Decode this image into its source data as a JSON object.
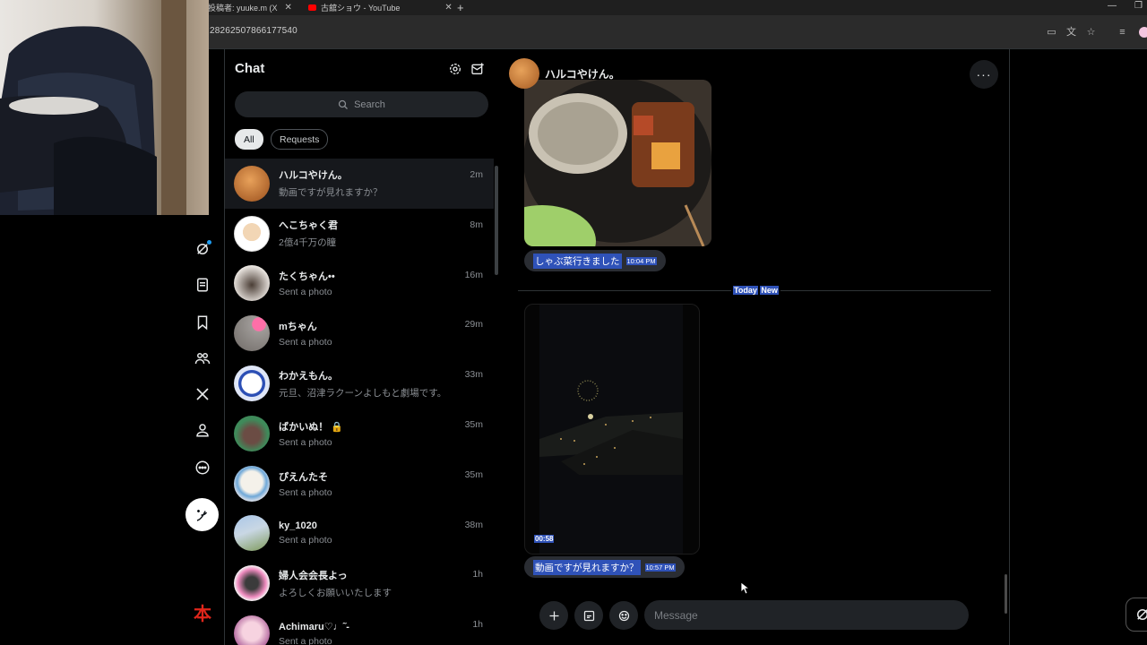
{
  "browser": {
    "tabs": [
      {
        "title": "投稿者: yuuke.m (X"
      },
      {
        "title": "古舘ショウ - YouTube"
      }
    ],
    "new_tab": "+",
    "url": "28262507866177540"
  },
  "chat_list": {
    "title": "Chat",
    "search": {
      "placeholder": "Search"
    },
    "filters": {
      "all": "All",
      "requests": "Requests"
    },
    "conversations": [
      {
        "name": "ハルコやけん。",
        "preview": "動画ですが見れますか？",
        "time": "2m",
        "selected": true
      },
      {
        "name": "へこちゃく君",
        "preview": "2億4千万の瞳",
        "time": "8m"
      },
      {
        "name": "たくちゃん••",
        "preview": "Sent a photo",
        "time": "16m"
      },
      {
        "name": "mちゃん",
        "preview": "Sent a photo",
        "time": "29m"
      },
      {
        "name": "わかえもん。",
        "preview": "元旦、沼津ラクーンよしもと劇場です。",
        "time": "33m"
      },
      {
        "name": "ばかいぬ！",
        "preview": "Sent a photo",
        "time": "35m"
      },
      {
        "name": "ぴえんたそ",
        "preview": "Sent a photo",
        "time": "35m"
      },
      {
        "name": "ky_1020",
        "preview": "Sent a photo",
        "time": "38m"
      },
      {
        "name": "婦人会会長よっ",
        "preview": "よろしくお願いいたします",
        "time": "1h"
      },
      {
        "name": "Achimaru♡♩˜-",
        "preview": "Sent a photo",
        "time": "1h"
      }
    ]
  },
  "conversation": {
    "partner_name": "ハルコやけん。",
    "more": "···",
    "messages": [
      {
        "text": "しゃぶ菜行きました",
        "time": "10:04 PM"
      },
      {
        "text": "動画ですが見れますか？",
        "time": "10:57 PM"
      }
    ],
    "divider": {
      "label": "Today",
      "badge": "New"
    },
    "video_duration": "00:58",
    "composer": {
      "placeholder": "Message"
    }
  },
  "nav_icons": [
    "grok-icon",
    "lists-icon",
    "bookmarks-icon",
    "communities-icon",
    "x-logo-icon",
    "profile-icon",
    "more-icon",
    "post-icon"
  ],
  "colors": {
    "accent": "#1d9bf0",
    "highlight": "#2f52b8",
    "background": "#000000"
  }
}
